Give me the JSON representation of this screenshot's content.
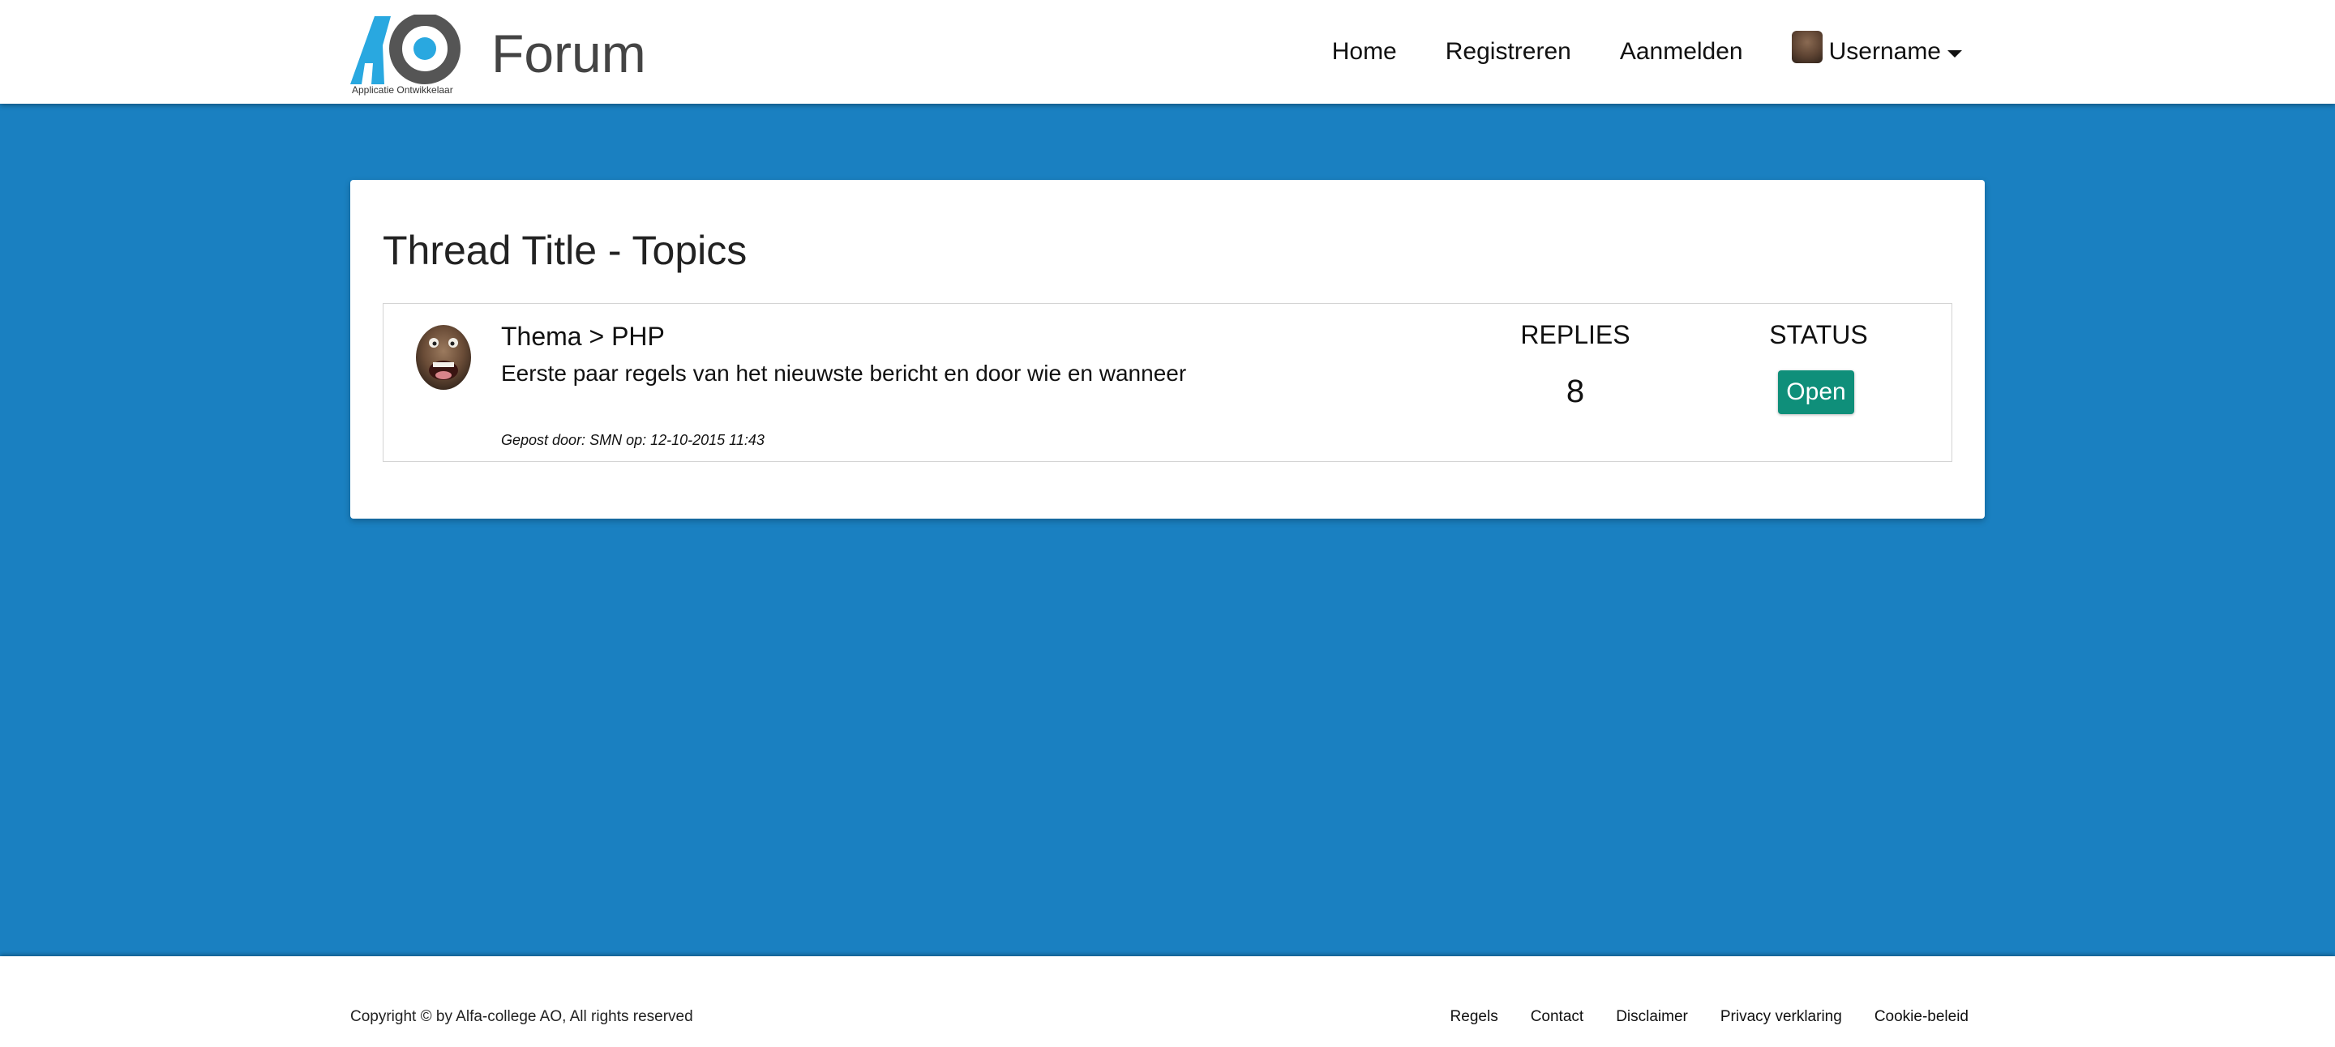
{
  "header": {
    "logo_caption": "Applicatie Ontwikkelaar",
    "title": "Forum",
    "nav": {
      "home": "Home",
      "register": "Registreren",
      "login": "Aanmelden",
      "user": "Username"
    }
  },
  "main": {
    "title": "Thread Title - Topics",
    "topic": {
      "heading": "Thema > PHP",
      "excerpt": "Eerste paar regels van het nieuwste bericht en door wie en wanneer",
      "meta": "Gepost door: SMN op: 12-10-2015 11:43",
      "replies_label": "REPLIES",
      "replies_count": "8",
      "status_label": "STATUS",
      "status": "Open"
    }
  },
  "footer": {
    "copyright": "Copyright © by Alfa-college AO, All rights reserved",
    "links": [
      "Regels",
      "Contact",
      "Disclaimer",
      "Privacy verklaring",
      "Cookie-beleid"
    ]
  },
  "colors": {
    "background": "#1a80c1",
    "logo_blue": "#29a8e0",
    "logo_gray": "#555555",
    "status_open": "#0f8f7a"
  },
  "icons": {
    "logo": "ao-logo",
    "user_avatar": "avatar-icon",
    "dropdown": "caret-down-icon"
  }
}
